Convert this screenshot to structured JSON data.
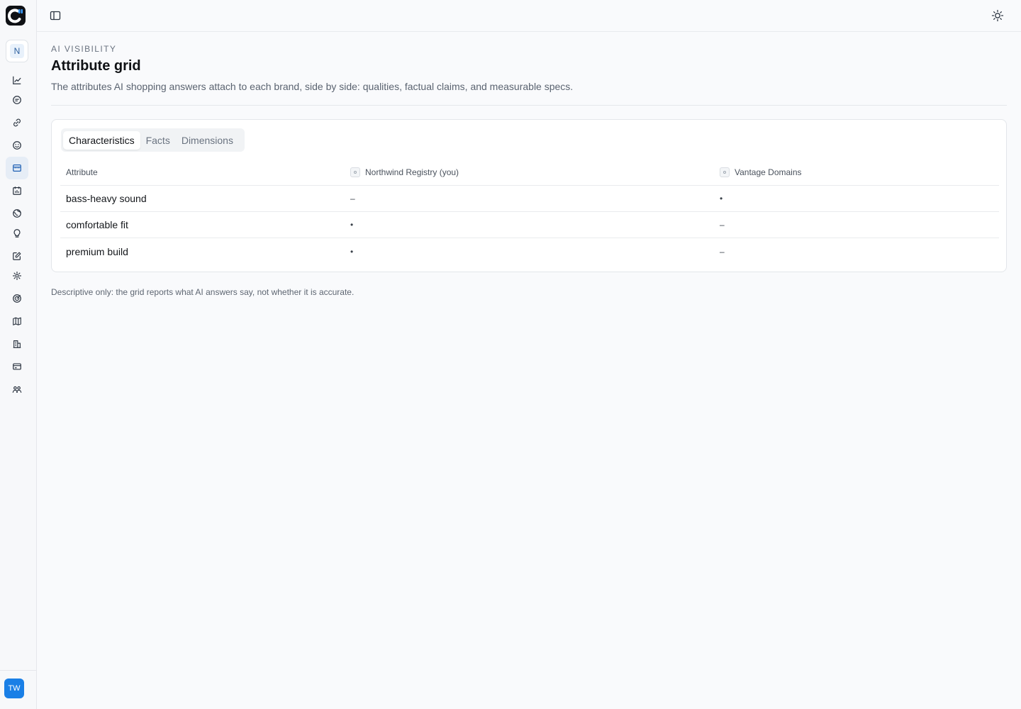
{
  "workspace": {
    "initial": "N"
  },
  "user": {
    "initials": "TW"
  },
  "nav": {
    "icons": [
      "trend-chart-icon",
      "chat-bubble-icon",
      "link-icon",
      "smiley-icon",
      "storefront-icon",
      "calendar-chart-icon",
      "globe-icon",
      "lightbulb-icon",
      "edit-note-icon",
      "settings-gear-icon",
      "target-icon",
      "map-icon",
      "building-icon",
      "credit-card-icon",
      "team-icon"
    ],
    "active_index": 4
  },
  "header": {
    "eyebrow": "AI VISIBILITY",
    "title": "Attribute grid",
    "subtitle": "The attributes AI shopping answers attach to each brand, side by side: qualities, factual claims, and measurable specs."
  },
  "tabs": [
    {
      "label": "Characteristics",
      "active": true
    },
    {
      "label": "Facts",
      "active": false
    },
    {
      "label": "Dimensions",
      "active": false
    }
  ],
  "grid": {
    "columns": [
      "Attribute",
      "Northwind Registry (you)",
      "Vantage Domains"
    ],
    "rows": [
      {
        "attribute": "bass-heavy sound",
        "northwind": "–",
        "vantage": "•"
      },
      {
        "attribute": "comfortable fit",
        "northwind": "•",
        "vantage": "–"
      },
      {
        "attribute": "premium build",
        "northwind": "•",
        "vantage": "–"
      }
    ]
  },
  "footnote": "Descriptive only: the grid reports what AI answers say, not whether it is accurate.",
  "colors": {
    "accent": "#1a7fe6",
    "active_nav": "#e6edf6",
    "nav_icon": "#2b3440",
    "nav_active_icon": "#1e5fb3"
  }
}
